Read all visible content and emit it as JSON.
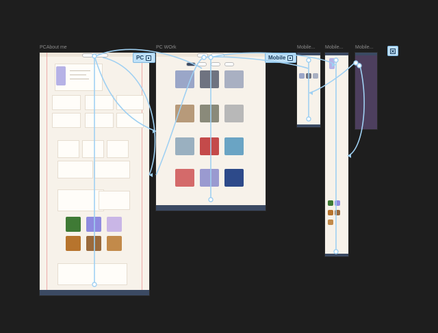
{
  "frames": {
    "about": {
      "title": "PCAbout me"
    },
    "work": {
      "title": "PC WOrk"
    },
    "mobile1": {
      "title": "Mobile..."
    },
    "mobile2": {
      "title": "Mobile..."
    },
    "mobile3": {
      "title": "Mobile..."
    }
  },
  "badges": {
    "pc": "PC",
    "mobile": "Mobile"
  },
  "icons": {
    "close": "close-icon",
    "frame": "frame-icon",
    "flow_node": "flow-node-icon"
  },
  "colors": {
    "canvas": "#1e1e1e",
    "frame_bg": "#f7f2ea",
    "footer": "#3b4a63",
    "flow": "#9fd0f2",
    "badge": "#bfe0f7",
    "guide": "#e98b8b"
  }
}
